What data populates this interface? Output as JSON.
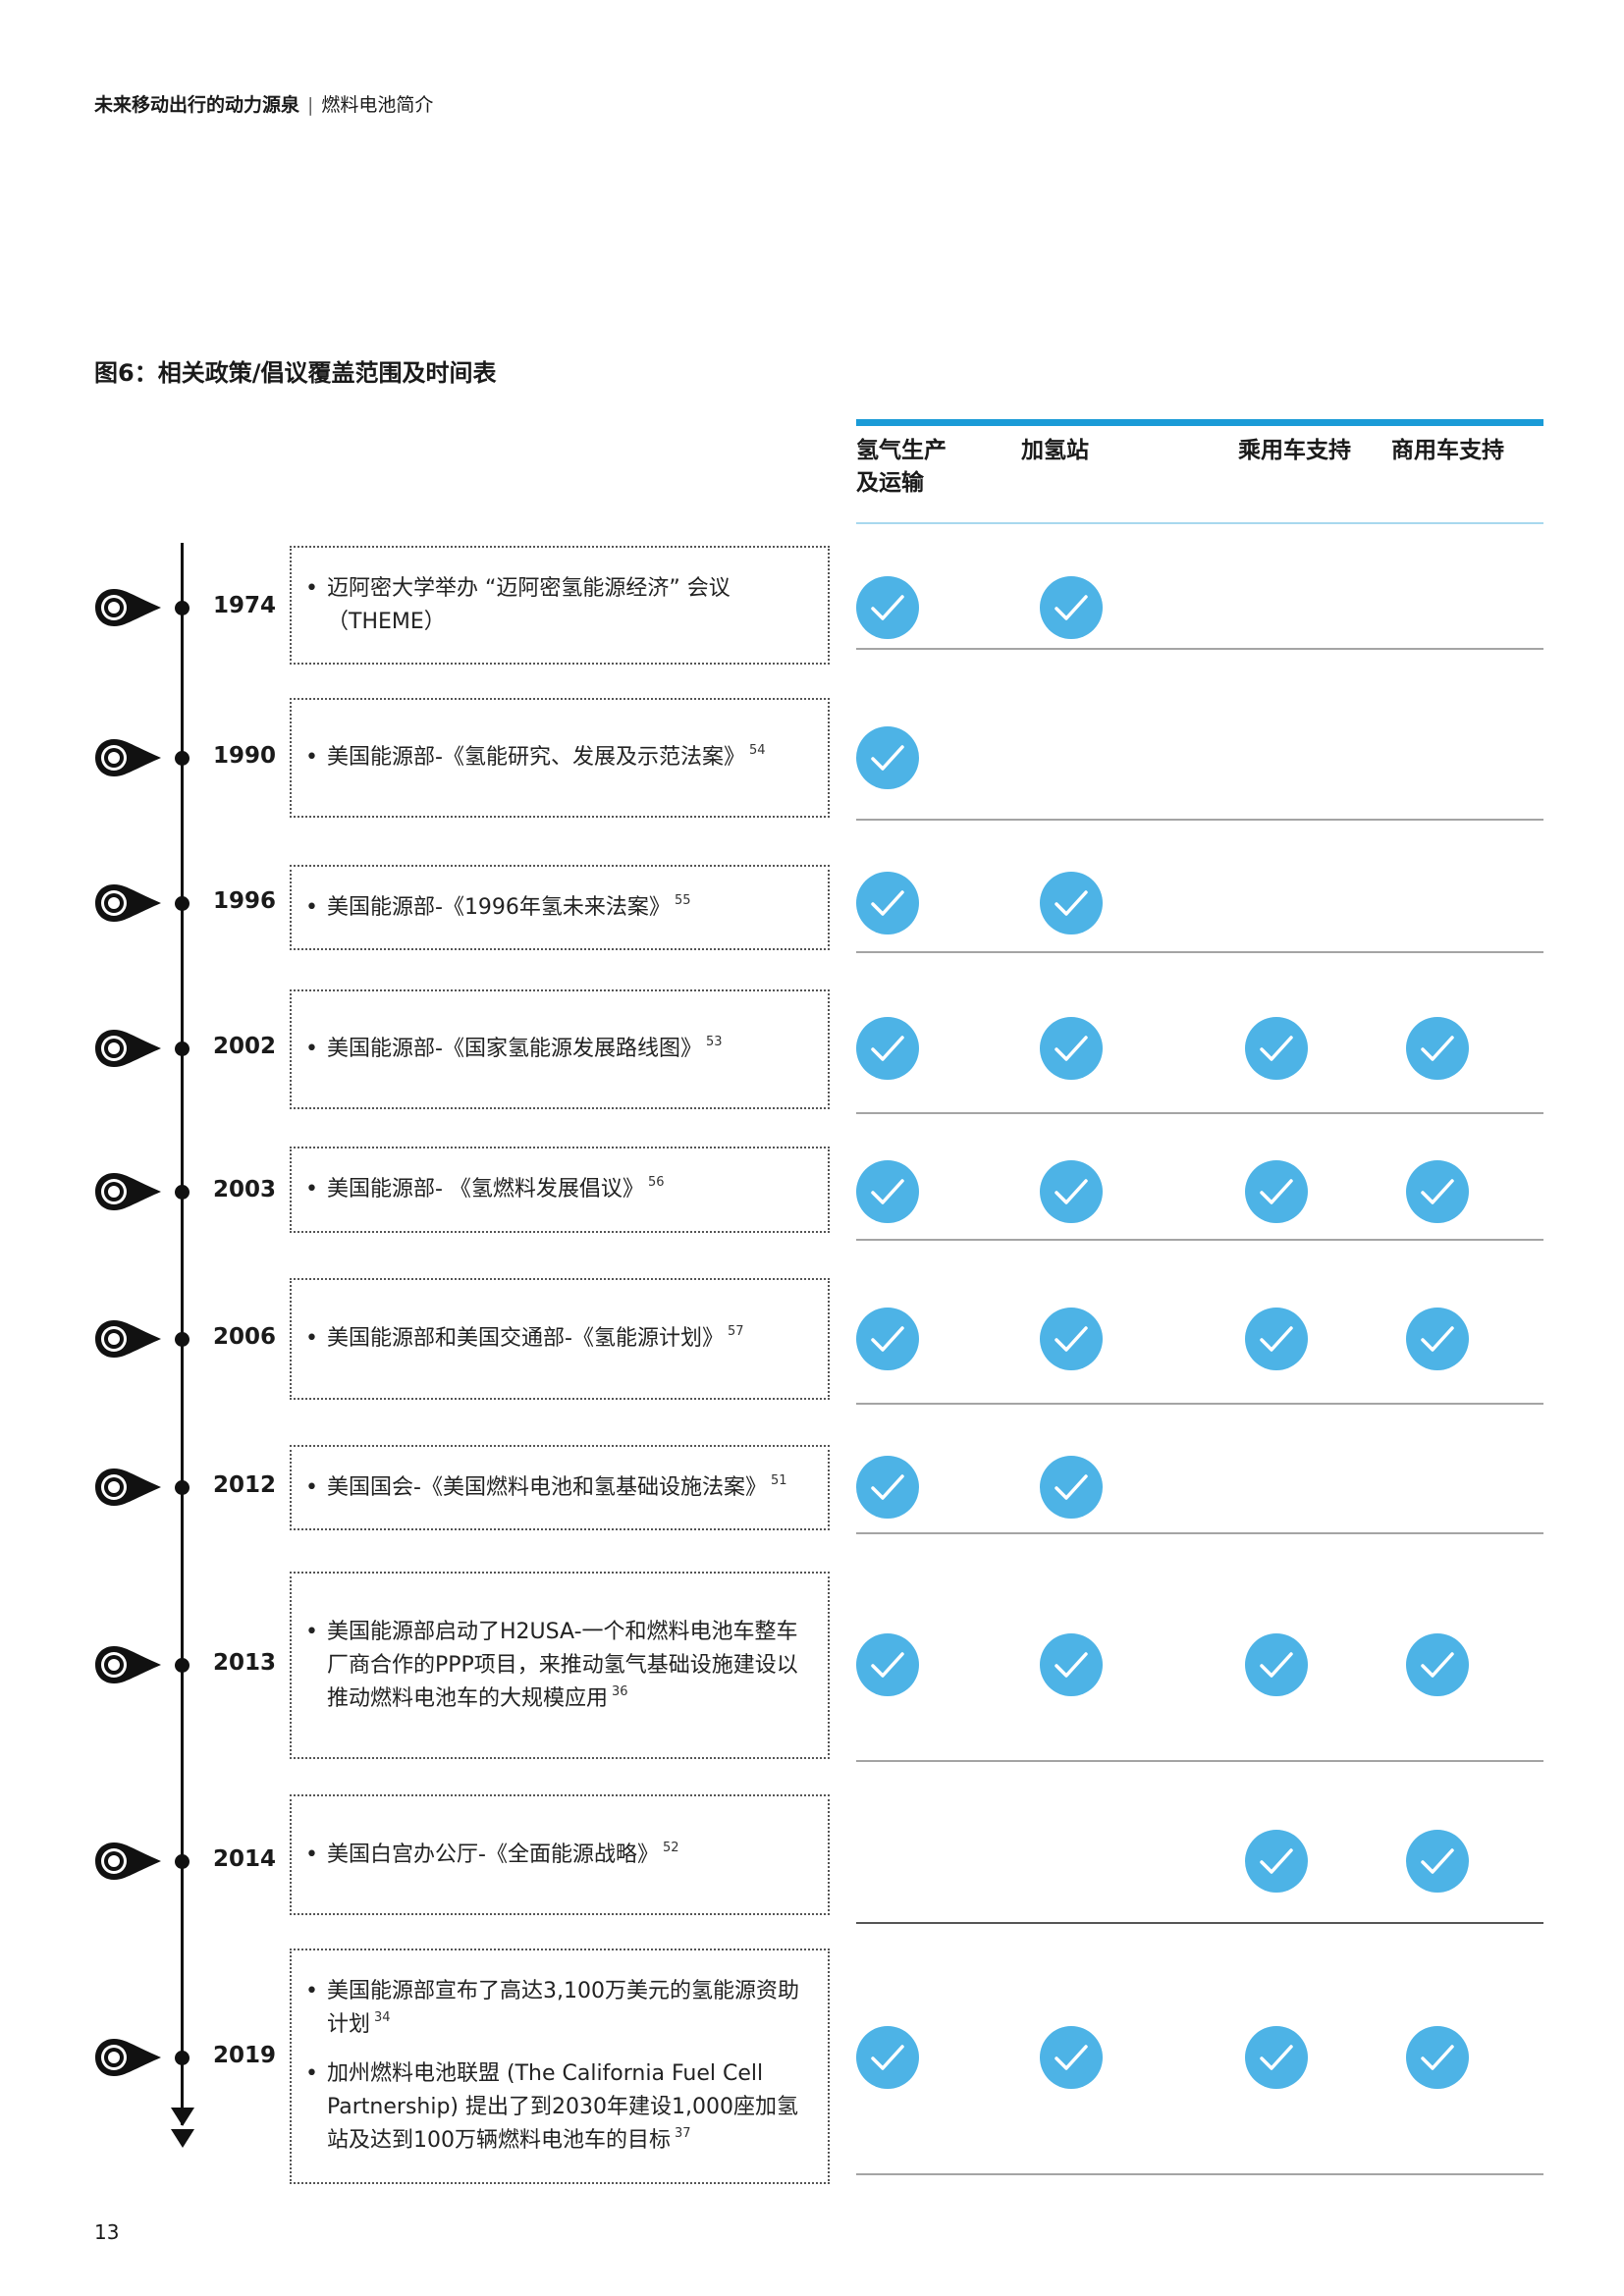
{
  "header": {
    "title": "未来移动出行的动力源泉",
    "separator": "|",
    "section": "燃料电池简介"
  },
  "figure_title": "图6：相关政策/倡议覆盖范围及时间表",
  "columns": [
    {
      "line1": "氢气生产",
      "line2": "及运输"
    },
    {
      "line1": "加氢站",
      "line2": ""
    },
    {
      "line1": "乘用车支持",
      "line2": ""
    },
    {
      "line1": "商用车支持",
      "line2": ""
    }
  ],
  "rows": [
    {
      "year": "1974",
      "items": [
        {
          "text": "迈阿密大学举办 “迈阿密氢能源经济” 会议 （THEME）",
          "ref": ""
        }
      ],
      "checks": [
        true,
        true,
        false,
        false
      ]
    },
    {
      "year": "1990",
      "items": [
        {
          "text": "美国能源部-《氢能研究、发展及示范法案》",
          "ref": "54"
        }
      ],
      "checks": [
        true,
        false,
        false,
        false
      ]
    },
    {
      "year": "1996",
      "items": [
        {
          "text": "美国能源部-《1996年氢未来法案》",
          "ref": "55"
        }
      ],
      "checks": [
        true,
        true,
        false,
        false
      ]
    },
    {
      "year": "2002",
      "items": [
        {
          "text": "美国能源部-《国家氢能源发展路线图》",
          "ref": "53"
        }
      ],
      "checks": [
        true,
        true,
        true,
        true
      ]
    },
    {
      "year": "2003",
      "items": [
        {
          "text": "美国能源部- 《氢燃料发展倡议》",
          "ref": "56"
        }
      ],
      "checks": [
        true,
        true,
        true,
        true
      ]
    },
    {
      "year": "2006",
      "items": [
        {
          "text": "美国能源部和美国交通部-《氢能源计划》",
          "ref": "57"
        }
      ],
      "checks": [
        true,
        true,
        true,
        true
      ]
    },
    {
      "year": "2012",
      "items": [
        {
          "text": "美国国会-《美国燃料电池和氢基础设施法案》",
          "ref": "51"
        }
      ],
      "checks": [
        true,
        true,
        false,
        false
      ]
    },
    {
      "year": "2013",
      "items": [
        {
          "text": "美国能源部启动了H2USA-一个和燃料电池车整车厂商合作的PPP项目，来推动氢气基础设施建设以推动燃料电池车的大规模应用",
          "ref": "36"
        }
      ],
      "checks": [
        true,
        true,
        true,
        true
      ]
    },
    {
      "year": "2014",
      "items": [
        {
          "text": "美国白宫办公厅-《全面能源战略》",
          "ref": "52"
        }
      ],
      "checks": [
        false,
        false,
        true,
        true
      ]
    },
    {
      "year": "2019",
      "items": [
        {
          "text": "美国能源部宣布了高达3,100万美元的氢能源资助计划",
          "ref": "34"
        },
        {
          "text": "加州燃料电池联盟 (The California Fuel Cell Partnership) 提出了到2030年建设1,000座加氢站及达到100万辆燃料电池车的目标",
          "ref": "37"
        }
      ],
      "checks": [
        true,
        true,
        true,
        true
      ]
    }
  ],
  "bullet_char": "•",
  "page_number": "13",
  "colors": {
    "accent_blue": "#1a9bd7",
    "check_fill": "#4db3e6",
    "header_line": "#a8d8ee",
    "row_rule": "#a4a4a4",
    "timeline": "#111111"
  },
  "icons": {
    "check": "check-circle-icon",
    "pin": "location-pin-icon",
    "arrow": "arrow-down-icon"
  }
}
